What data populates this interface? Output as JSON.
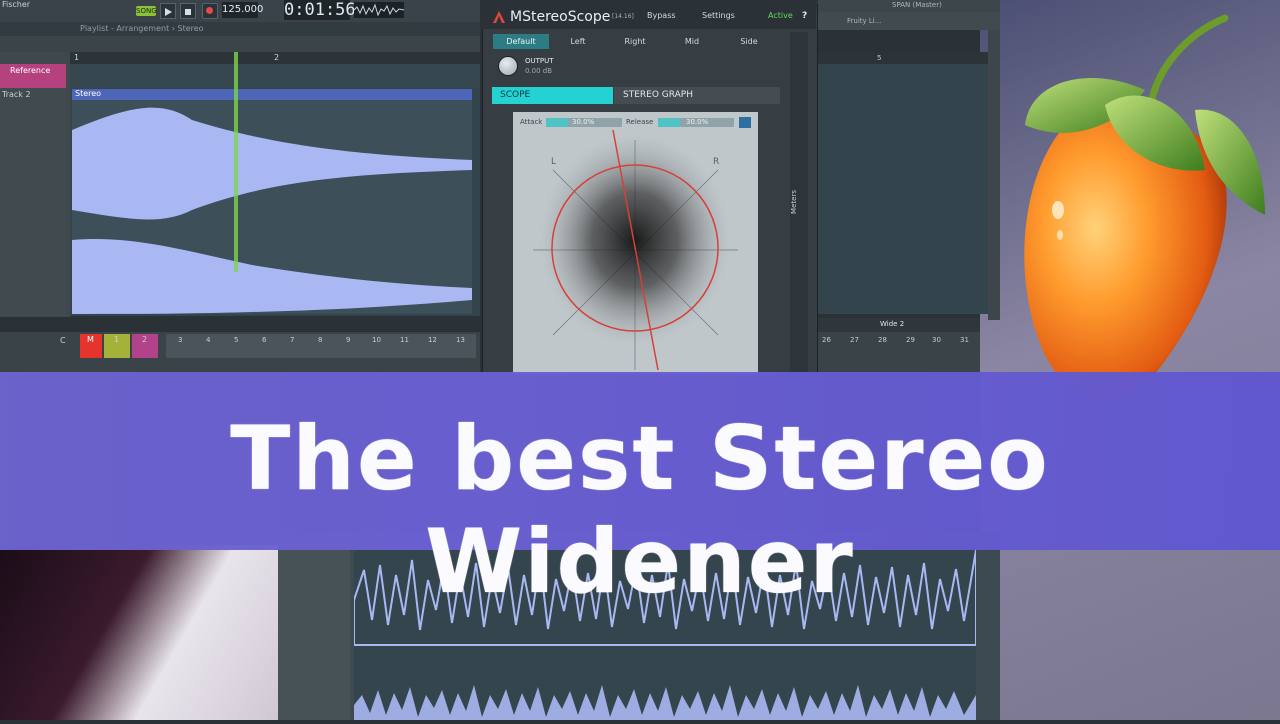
{
  "toolbar": {
    "user": "Fischer",
    "song_label": "SONG",
    "tempo": "125.000",
    "time": "0:01:56"
  },
  "playlist": {
    "breadcrumb": "Playlist - Arrangement › Stereo",
    "tracks": [
      {
        "label": "Reference"
      },
      {
        "label": "Track 2"
      }
    ],
    "clip_label": "Stereo",
    "ruler": [
      "1",
      "2"
    ]
  },
  "rack": {
    "channels": [
      "C",
      "M",
      "1",
      "2"
    ],
    "steps": [
      "3",
      "4",
      "5",
      "6",
      "7",
      "8",
      "9",
      "10",
      "11",
      "12",
      "13"
    ]
  },
  "plugin": {
    "title": "MStereoScope",
    "version": "[14.16]",
    "bypass": "Bypass",
    "settings": "Settings",
    "active": "Active",
    "help": "?",
    "tabs": [
      "Default",
      "Left",
      "Right",
      "Mid",
      "Side"
    ],
    "output_label": "OUTPUT",
    "output_value": "0.00 dB",
    "view_tabs": [
      "SCOPE",
      "STEREO GRAPH"
    ],
    "attack_label": "Attack",
    "attack_value": "30.0%",
    "release_label": "Release",
    "release_value": "30.0%",
    "channel_l": "L",
    "channel_r": "R",
    "meters_label": "Meters"
  },
  "right_panel": {
    "fruity": "Fruity Li...",
    "span": "SPAN (Master)",
    "ruler_5": "5",
    "wide_label": "Wide 2",
    "steps": [
      "26",
      "27",
      "28",
      "29",
      "30",
      "31"
    ]
  },
  "banner": {
    "text": "The best Stereo Widener"
  },
  "colors": {
    "accent": "#24d1d3",
    "banner": "#6a5fd2",
    "wave": "#a9b8f2",
    "active": "#5fdc59"
  }
}
